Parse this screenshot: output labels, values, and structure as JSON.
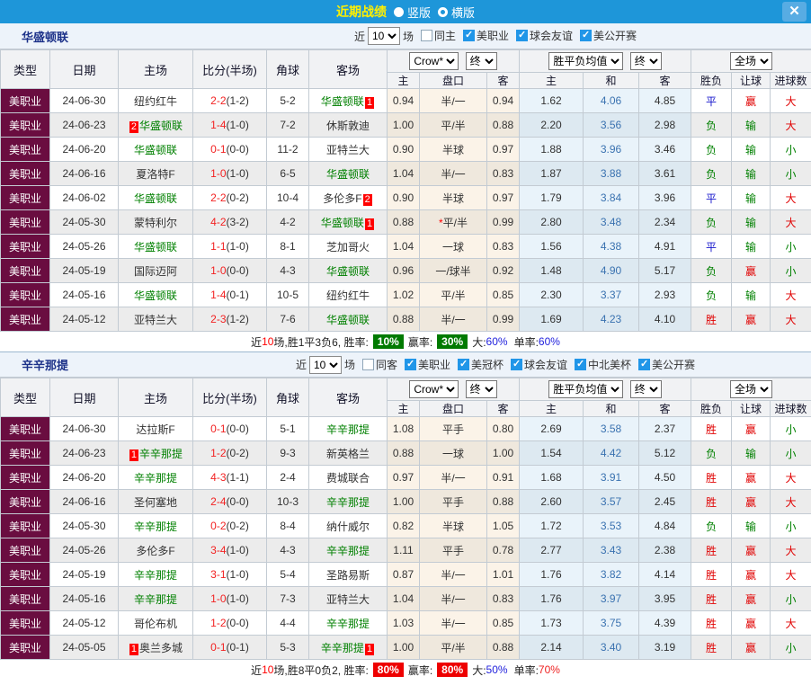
{
  "titlebar": {
    "title": "近期战绩",
    "layout_options": [
      {
        "label": "竖版",
        "selected": true
      },
      {
        "label": "横版",
        "selected": false
      }
    ],
    "close_label": "✕"
  },
  "table": {
    "main_columns": [
      "类型",
      "日期",
      "主场",
      "比分(半场)",
      "角球",
      "客场"
    ],
    "sub_columns": [
      "主",
      "盘口",
      "客",
      "主",
      "和",
      "客",
      "胜负",
      "让球",
      "进球数"
    ],
    "selects": {
      "company": "Crow*",
      "company_time": "终",
      "avg": "胜平负均值",
      "avg_time": "终",
      "scope": "全场"
    }
  },
  "result_colors": {
    "胜": "#e00000",
    "平": "#1515cc",
    "负": "#008000",
    "赢": "#e00000",
    "输": "#008000",
    "大": "#e00000",
    "小": "#008000"
  },
  "sections": [
    {
      "team": "华盛顿联",
      "filter": {
        "near": "近",
        "count": "10",
        "games": "场",
        "checkboxes": [
          {
            "label": "同主",
            "checked": false
          },
          {
            "label": "美职业",
            "checked": true
          },
          {
            "label": "球会友谊",
            "checked": true
          },
          {
            "label": "美公开赛",
            "checked": true
          }
        ]
      },
      "rows": [
        {
          "type": "美职业",
          "date": "24-06-30",
          "home": "纽约红牛",
          "score": "2-2",
          "half": "(1-2)",
          "corner": "5-2",
          "away": "华盛顿联",
          "awayPost": "1",
          "oddsH": "0.94",
          "line": "半/一",
          "oddsA": "0.94",
          "avgH": "1.62",
          "avgD": "4.06",
          "avgA": "4.85",
          "res": "平",
          "hcap": "赢",
          "goals": "大"
        },
        {
          "type": "美职业",
          "date": "24-06-23",
          "home": "华盛顿联",
          "homePre": "2",
          "score": "1-4",
          "half": "(1-0)",
          "corner": "7-2",
          "away": "休斯敦迪",
          "oddsH": "1.00",
          "line": "平/半",
          "oddsA": "0.88",
          "avgH": "2.20",
          "avgD": "3.56",
          "avgA": "2.98",
          "res": "负",
          "hcap": "输",
          "goals": "大"
        },
        {
          "type": "美职业",
          "date": "24-06-20",
          "home": "华盛顿联",
          "score": "0-1",
          "half": "(0-0)",
          "corner": "11-2",
          "away": "亚特兰大",
          "oddsH": "0.90",
          "line": "半球",
          "oddsA": "0.97",
          "avgH": "1.88",
          "avgD": "3.96",
          "avgA": "3.46",
          "res": "负",
          "hcap": "输",
          "goals": "小"
        },
        {
          "type": "美职业",
          "date": "24-06-16",
          "home": "夏洛特F",
          "score": "1-0",
          "half": "(1-0)",
          "corner": "6-5",
          "away": "华盛顿联",
          "oddsH": "1.04",
          "line": "半/一",
          "oddsA": "0.83",
          "avgH": "1.87",
          "avgD": "3.88",
          "avgA": "3.61",
          "res": "负",
          "hcap": "输",
          "goals": "小"
        },
        {
          "type": "美职业",
          "date": "24-06-02",
          "home": "华盛顿联",
          "score": "2-2",
          "half": "(0-2)",
          "corner": "10-4",
          "away": "多伦多F",
          "awayPost": "2",
          "oddsH": "0.90",
          "line": "半球",
          "oddsA": "0.97",
          "avgH": "1.79",
          "avgD": "3.84",
          "avgA": "3.96",
          "res": "平",
          "hcap": "输",
          "goals": "大"
        },
        {
          "type": "美职业",
          "date": "24-05-30",
          "home": "蒙特利尔",
          "score": "4-2",
          "half": "(3-2)",
          "corner": "4-2",
          "away": "华盛顿联",
          "awayPost": "1",
          "oddsH": "0.88",
          "star": "*",
          "line": "平/半",
          "oddsA": "0.99",
          "avgH": "2.80",
          "avgD": "3.48",
          "avgA": "2.34",
          "res": "负",
          "hcap": "输",
          "goals": "大"
        },
        {
          "type": "美职业",
          "date": "24-05-26",
          "home": "华盛顿联",
          "score": "1-1",
          "half": "(1-0)",
          "corner": "8-1",
          "away": "芝加哥火",
          "oddsH": "1.04",
          "line": "一球",
          "oddsA": "0.83",
          "avgH": "1.56",
          "avgD": "4.38",
          "avgA": "4.91",
          "res": "平",
          "hcap": "输",
          "goals": "小"
        },
        {
          "type": "美职业",
          "date": "24-05-19",
          "home": "国际迈阿",
          "score": "1-0",
          "half": "(0-0)",
          "corner": "4-3",
          "away": "华盛顿联",
          "oddsH": "0.96",
          "line": "一/球半",
          "oddsA": "0.92",
          "avgH": "1.48",
          "avgD": "4.90",
          "avgA": "5.17",
          "res": "负",
          "hcap": "赢",
          "goals": "小"
        },
        {
          "type": "美职业",
          "date": "24-05-16",
          "home": "华盛顿联",
          "score": "1-4",
          "half": "(0-1)",
          "corner": "10-5",
          "away": "纽约红牛",
          "oddsH": "1.02",
          "line": "平/半",
          "oddsA": "0.85",
          "avgH": "2.30",
          "avgD": "3.37",
          "avgA": "2.93",
          "res": "负",
          "hcap": "输",
          "goals": "大"
        },
        {
          "type": "美职业",
          "date": "24-05-12",
          "home": "亚特兰大",
          "score": "2-3",
          "half": "(1-2)",
          "corner": "7-6",
          "away": "华盛顿联",
          "oddsH": "0.88",
          "line": "半/一",
          "oddsA": "0.99",
          "avgH": "1.69",
          "avgD": "4.23",
          "avgA": "4.10",
          "res": "胜",
          "hcap": "赢",
          "goals": "大"
        }
      ],
      "footer": {
        "near": "近",
        "count": "10",
        "summary": "场,胜1平3负6, 胜率:",
        "rate": "10%",
        "rate_bg": "#007a00",
        "win_label": "赢率:",
        "win_rate": "30%",
        "win_bg": "#007a00",
        "big_label": "大:",
        "big": "60%",
        "big_color": "#2222dd",
        "single_label": "单率:",
        "single": "60%",
        "single_color": "#2222dd"
      }
    },
    {
      "team": "辛辛那提",
      "filter": {
        "near": "近",
        "count": "10",
        "games": "场",
        "checkboxes": [
          {
            "label": "同客",
            "checked": false
          },
          {
            "label": "美职业",
            "checked": true
          },
          {
            "label": "美冠杯",
            "checked": true
          },
          {
            "label": "球会友谊",
            "checked": true
          },
          {
            "label": "中北美杯",
            "checked": true
          },
          {
            "label": "美公开赛",
            "checked": true
          }
        ]
      },
      "rows": [
        {
          "type": "美职业",
          "date": "24-06-30",
          "home": "达拉斯F",
          "score": "0-1",
          "half": "(0-0)",
          "corner": "5-1",
          "away": "辛辛那提",
          "oddsH": "1.08",
          "line": "平手",
          "oddsA": "0.80",
          "avgH": "2.69",
          "avgD": "3.58",
          "avgA": "2.37",
          "res": "胜",
          "hcap": "赢",
          "goals": "小"
        },
        {
          "type": "美职业",
          "date": "24-06-23",
          "home": "辛辛那提",
          "homePre": "1",
          "score": "1-2",
          "half": "(0-2)",
          "corner": "9-3",
          "away": "新英格兰",
          "oddsH": "0.88",
          "line": "一球",
          "oddsA": "1.00",
          "avgH": "1.54",
          "avgD": "4.42",
          "avgA": "5.12",
          "res": "负",
          "hcap": "输",
          "goals": "小"
        },
        {
          "type": "美职业",
          "date": "24-06-20",
          "home": "辛辛那提",
          "score": "4-3",
          "half": "(1-1)",
          "corner": "2-4",
          "away": "费城联合",
          "oddsH": "0.97",
          "line": "半/一",
          "oddsA": "0.91",
          "avgH": "1.68",
          "avgD": "3.91",
          "avgA": "4.50",
          "res": "胜",
          "hcap": "赢",
          "goals": "大"
        },
        {
          "type": "美职业",
          "date": "24-06-16",
          "home": "圣何塞地",
          "score": "2-4",
          "half": "(0-0)",
          "corner": "10-3",
          "away": "辛辛那提",
          "oddsH": "1.00",
          "line": "平手",
          "oddsA": "0.88",
          "avgH": "2.60",
          "avgD": "3.57",
          "avgA": "2.45",
          "res": "胜",
          "hcap": "赢",
          "goals": "大"
        },
        {
          "type": "美职业",
          "date": "24-05-30",
          "home": "辛辛那提",
          "score": "0-2",
          "half": "(0-2)",
          "corner": "8-4",
          "away": "纳什威尔",
          "oddsH": "0.82",
          "line": "半球",
          "oddsA": "1.05",
          "avgH": "1.72",
          "avgD": "3.53",
          "avgA": "4.84",
          "res": "负",
          "hcap": "输",
          "goals": "小"
        },
        {
          "type": "美职业",
          "date": "24-05-26",
          "home": "多伦多F",
          "score": "3-4",
          "half": "(1-0)",
          "corner": "4-3",
          "away": "辛辛那提",
          "oddsH": "1.11",
          "line": "平手",
          "oddsA": "0.78",
          "avgH": "2.77",
          "avgD": "3.43",
          "avgA": "2.38",
          "res": "胜",
          "hcap": "赢",
          "goals": "大"
        },
        {
          "type": "美职业",
          "date": "24-05-19",
          "home": "辛辛那提",
          "score": "3-1",
          "half": "(1-0)",
          "corner": "5-4",
          "away": "圣路易斯",
          "oddsH": "0.87",
          "line": "半/一",
          "oddsA": "1.01",
          "avgH": "1.76",
          "avgD": "3.82",
          "avgA": "4.14",
          "res": "胜",
          "hcap": "赢",
          "goals": "大"
        },
        {
          "type": "美职业",
          "date": "24-05-16",
          "home": "辛辛那提",
          "score": "1-0",
          "half": "(1-0)",
          "corner": "7-3",
          "away": "亚特兰大",
          "oddsH": "1.04",
          "line": "半/一",
          "oddsA": "0.83",
          "avgH": "1.76",
          "avgD": "3.97",
          "avgA": "3.95",
          "res": "胜",
          "hcap": "赢",
          "goals": "小"
        },
        {
          "type": "美职业",
          "date": "24-05-12",
          "home": "哥伦布机",
          "score": "1-2",
          "half": "(0-0)",
          "corner": "4-4",
          "away": "辛辛那提",
          "oddsH": "1.03",
          "line": "半/一",
          "oddsA": "0.85",
          "avgH": "1.73",
          "avgD": "3.75",
          "avgA": "4.39",
          "res": "胜",
          "hcap": "赢",
          "goals": "大"
        },
        {
          "type": "美职业",
          "date": "24-05-05",
          "home": "奥兰多城",
          "homePre": "1",
          "score": "0-1",
          "half": "(0-1)",
          "corner": "5-3",
          "away": "辛辛那提",
          "awayPost": "1",
          "oddsH": "1.00",
          "line": "平/半",
          "oddsA": "0.88",
          "avgH": "2.14",
          "avgD": "3.40",
          "avgA": "3.19",
          "res": "胜",
          "hcap": "赢",
          "goals": "小"
        }
      ],
      "footer": {
        "near": "近",
        "count": "10",
        "summary": "场,胜8平0负2, 胜率:",
        "rate": "80%",
        "rate_bg": "#ee0000",
        "win_label": "赢率:",
        "win_rate": "80%",
        "win_bg": "#ee0000",
        "big_label": "大:",
        "big": "50%",
        "big_color": "#2222dd",
        "single_label": "单率:",
        "single": "70%",
        "single_color": "#ee2222"
      }
    }
  ]
}
